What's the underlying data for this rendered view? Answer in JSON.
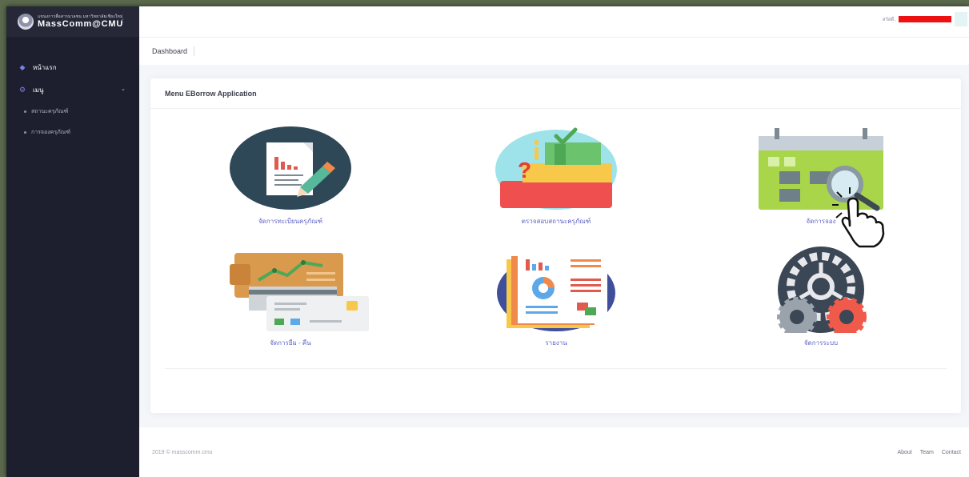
{
  "brand": {
    "subtitle": "แขนงการสื่อสารมวลชน มหาวิทยาลัยเชียงใหม่",
    "name": "MassComm@CMU",
    "collapse_icon": "chevron-left-icon"
  },
  "sidebar": {
    "items": [
      {
        "label": "หน้าแรก",
        "icon": "diamond-icon"
      },
      {
        "label": "เมนู",
        "icon": "gears-icon"
      }
    ],
    "subitems": [
      {
        "label": "สถานะครุภัณฑ์"
      },
      {
        "label": "การจองครุภัณฑ์"
      }
    ]
  },
  "topbar": {
    "greeting": "สวัสดี,"
  },
  "subheader": {
    "title": "Dashboard"
  },
  "card": {
    "title": "Menu EBorrow Application",
    "tiles": [
      {
        "label": "จัดการทะเบียนครุภัณฑ์",
        "icon": "document-edit-icon"
      },
      {
        "label": "ตรวจสอบสถานะครุภัณฑ์",
        "icon": "status-check-icon"
      },
      {
        "label": "จัดการจอง",
        "icon": "calendar-search-icon"
      },
      {
        "label": "จัดการยืม - คืน",
        "icon": "borrow-return-icon"
      },
      {
        "label": "รายงาน",
        "icon": "report-icon"
      },
      {
        "label": "จัดการระบบ",
        "icon": "settings-gear-icon"
      }
    ]
  },
  "footer": {
    "copyright": "2019 © masscomm.cmu",
    "links": [
      "About",
      "Team",
      "Contact"
    ]
  },
  "colors": {
    "sidebar_bg": "#1e1f2e",
    "accent": "#5e63c6",
    "redaction": "#ee1111"
  }
}
